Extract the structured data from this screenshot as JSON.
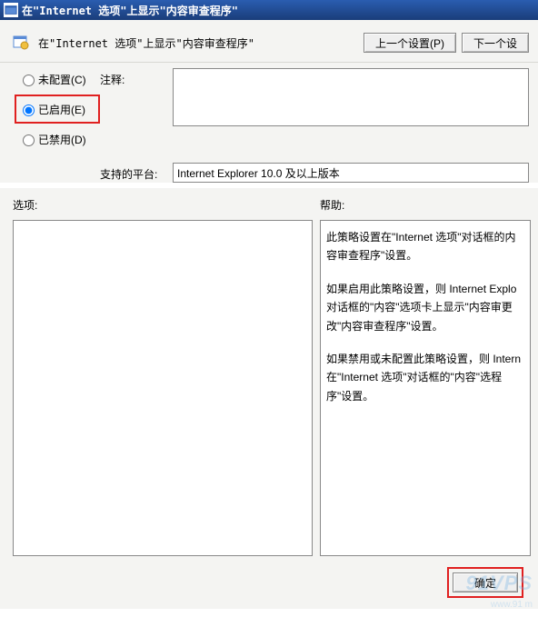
{
  "window": {
    "title": "在\"Internet 选项\"上显示\"内容审查程序\""
  },
  "header": {
    "title": "在\"Internet 选项\"上显示\"内容审查程序\"",
    "prev_button": "上一个设置(P)",
    "next_button": "下一个设"
  },
  "radios": {
    "not_configured": "未配置(C)",
    "enabled": "已启用(E)",
    "disabled": "已禁用(D)"
  },
  "labels": {
    "notes": "注释:",
    "platform": "支持的平台:",
    "options": "选项:",
    "help": "帮助:"
  },
  "fields": {
    "notes_value": "",
    "platform_value": "Internet Explorer 10.0 及以上版本"
  },
  "help": {
    "p1": "此策略设置在\"Internet 选项\"对话框的内容审查程序\"设置。",
    "p2": "如果启用此策略设置，则 Internet Explo对话框的\"内容\"选项卡上显示\"内容审更改\"内容审查程序\"设置。",
    "p3": "如果禁用或未配置此策略设置，则 Intern在\"Internet 选项\"对话框的\"内容\"选程序\"设置。"
  },
  "footer": {
    "ok": "确定"
  },
  "watermark": {
    "main": "91VPS",
    "sub": "www.91 m"
  }
}
